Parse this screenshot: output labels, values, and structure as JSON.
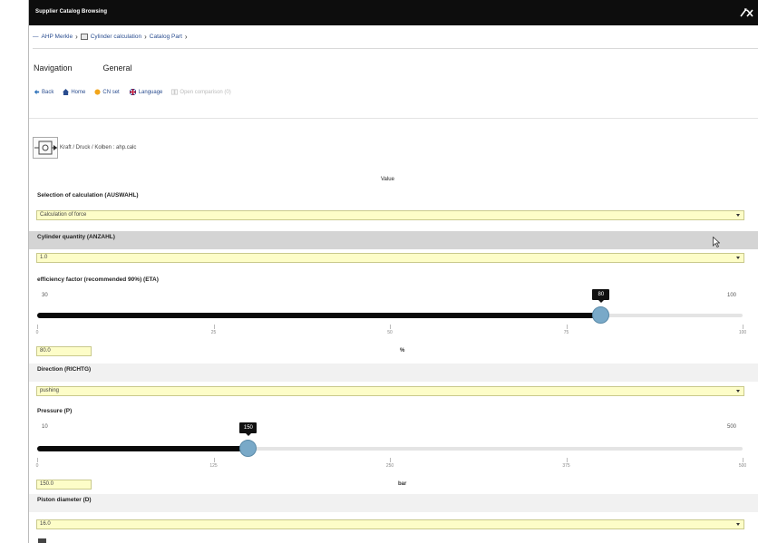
{
  "window": {
    "title": "Supplier Catalog Browsing"
  },
  "breadcrumb": {
    "items": [
      "AHP Merkle",
      "Cylinder calculation",
      "Catalog Part"
    ]
  },
  "tabs": [
    "Navigation",
    "General"
  ],
  "toolbar": {
    "back": "Back",
    "home": "Home",
    "cn": "CN set",
    "language": "Language",
    "disabled": "Open comparison (0)"
  },
  "part": {
    "path": "Kraft / Druck / Kolben : ahp.calc"
  },
  "columns": {
    "value": "Value"
  },
  "fields": {
    "selection": {
      "label": "Selection of calculation (AUSWAHL)",
      "value": "Calculation of force"
    },
    "quantity": {
      "label": "Cylinder quantity (ANZAHL)",
      "value": "1.0"
    },
    "eta": {
      "label": "efficiency factor (recommended 90%) (ETA)",
      "min": "30",
      "max": "100",
      "value": 80,
      "bubble": "80",
      "ticks": [
        "0",
        "25",
        "50",
        "75",
        "100"
      ],
      "box": "80.0",
      "unit": "%"
    },
    "direction": {
      "label": "Direction (RICHTG)",
      "value": "pushing"
    },
    "pressure": {
      "label": "Pressure (P)",
      "min": "10",
      "max": "500",
      "value": 150,
      "bubble": "150",
      "ticks": [
        "0",
        "125",
        "250",
        "375",
        "500"
      ],
      "box": "150.0",
      "unit": "bar"
    },
    "diameter": {
      "label": "Piston diameter (D)",
      "value": "16.0"
    }
  },
  "colors": {
    "titlebar": "#0d0d0d",
    "select_bg": "#fdfdc8",
    "knob": "#79a9c8",
    "highlight_row": "#d4d4d4"
  }
}
